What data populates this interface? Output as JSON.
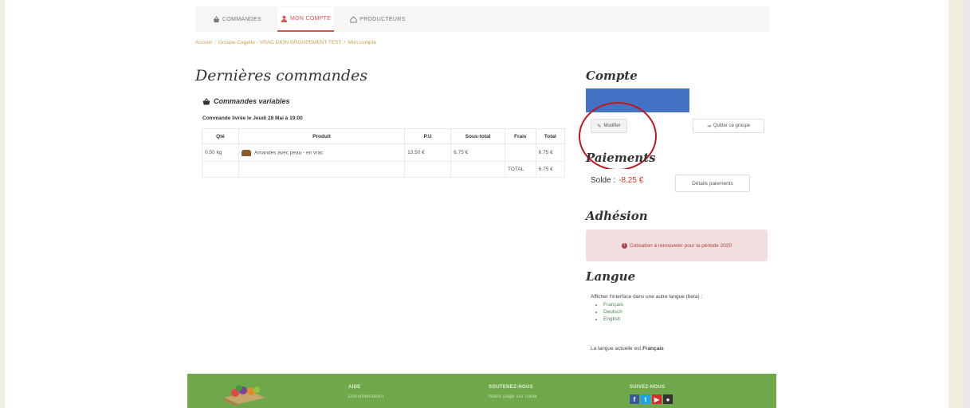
{
  "nav": {
    "tabs": [
      {
        "label": "COMMANDES"
      },
      {
        "label": "MON COMPTE"
      },
      {
        "label": "PRODUCTEURS"
      }
    ]
  },
  "breadcrumb": [
    "Accueil",
    "Groupe Cagette - VRAC DION GROUPEMENT TEST",
    "Mon compte"
  ],
  "orders": {
    "heading": "Dernières commandes",
    "card_title": "Commandes variables",
    "subtitle": "Commande livrée le Jeudi 28 Mai à 19:00",
    "columns": [
      "Qté",
      "Produit",
      "P.U",
      "Sous-total",
      "Frais",
      "Total"
    ],
    "rows": [
      {
        "qty": "0.50 kg",
        "product": "Amandes avec peau - en vrac",
        "unit_price": "13.50 €",
        "subtotal": "6.75 €",
        "fees": "",
        "total": "6.75 €"
      }
    ],
    "total_label": "TOTAL",
    "total_value": "6.75 €"
  },
  "account": {
    "heading": "Compte",
    "edit_label": "Modifier",
    "leave_label": "Quitter ce groupe"
  },
  "payments": {
    "heading": "Paiements",
    "balance_label": "Solde :",
    "balance_value": "-8.25 €",
    "details_label": "Détails paiements"
  },
  "membership": {
    "heading": "Adhésion",
    "alert": "Cotisation à renouveler pour la période 2020"
  },
  "language": {
    "heading": "Langue",
    "intro": "Afficher l'interface dans une autre langue (beta) :",
    "options": [
      "Français",
      "Deutsch",
      "English"
    ],
    "current_prefix": "La langue actuelle est",
    "current_value": "Français"
  },
  "footer": {
    "col1": {
      "head": "AIDE",
      "link": "Documentation"
    },
    "col2": {
      "head": "SOUTENEZ-NOUS",
      "link": "Notre page sur Ulule"
    },
    "col3": {
      "head": "SUIVEZ-NOUS"
    }
  },
  "colors": {
    "accent_red": "#d9534f",
    "footer_green": "#6ea84a",
    "highlight_blue": "#4472c4",
    "annotation_red": "#c0161d"
  }
}
